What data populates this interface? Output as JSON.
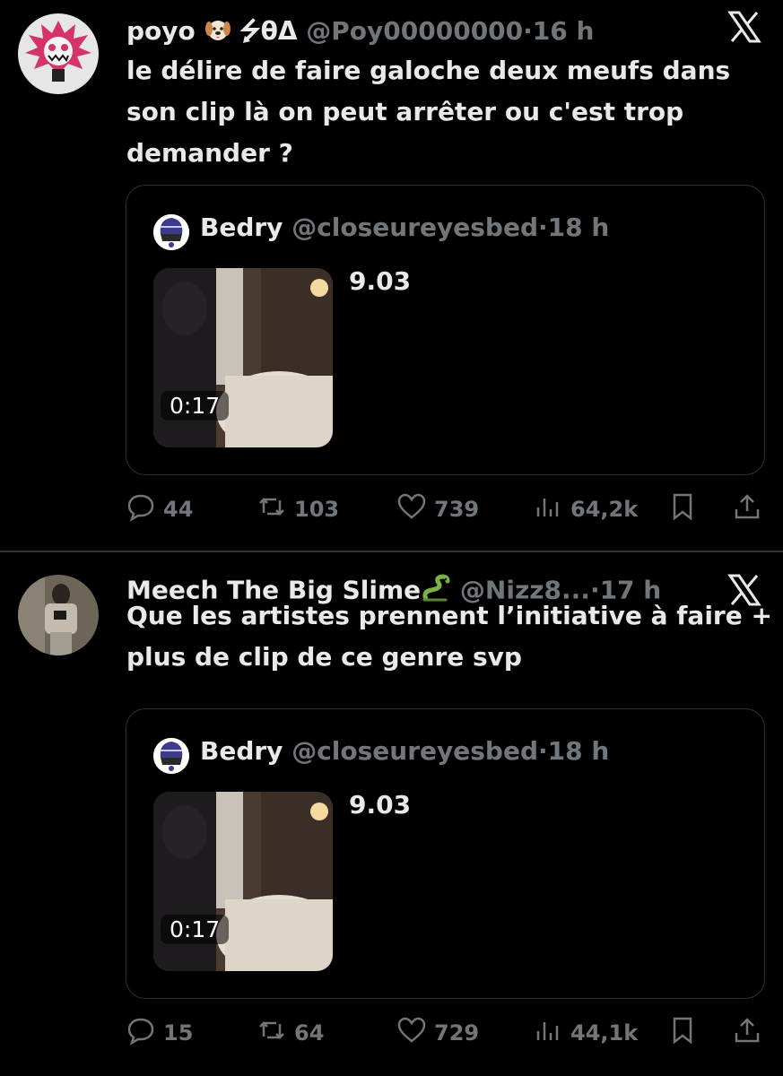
{
  "tweets": [
    {
      "display_name": "poyo",
      "name_suffix": "⭍θΔ",
      "handle": "@Poy00000000",
      "time": "16 h",
      "text": "le délire de faire galoche deux meufs dans son clip là on peut arrêter ou c'est trop demander ?",
      "quote": {
        "display_name": "Bedry",
        "handle": "@closeureyesbed",
        "time": "18 h",
        "text": "9.03",
        "video_duration": "0:17"
      },
      "replies": "44",
      "reposts": "103",
      "likes": "739",
      "views": "64,2k",
      "name_emoji": "dog-face-emoji"
    },
    {
      "display_name": "Meech The Big Slime",
      "handle": "@Nizz8...",
      "time": "17 h",
      "text": "Que les artistes prennent l’initiative à faire + plus de clip de ce genre svp",
      "quote": {
        "display_name": "Bedry",
        "handle": "@closeureyesbed",
        "time": "18 h",
        "text": "9.03",
        "video_duration": "0:17"
      },
      "replies": "15",
      "reposts": "64",
      "likes": "729",
      "views": "44,1k",
      "name_emoji": "snake-emoji"
    }
  ],
  "separator": "·",
  "colors": {
    "background": "#000000",
    "text": "#e7e9ea",
    "muted": "#71767b",
    "border": "#2f3336"
  },
  "icons": [
    "reply-icon",
    "repost-icon",
    "like-icon",
    "views-icon",
    "bookmark-icon",
    "share-icon",
    "x-logo-icon"
  ]
}
